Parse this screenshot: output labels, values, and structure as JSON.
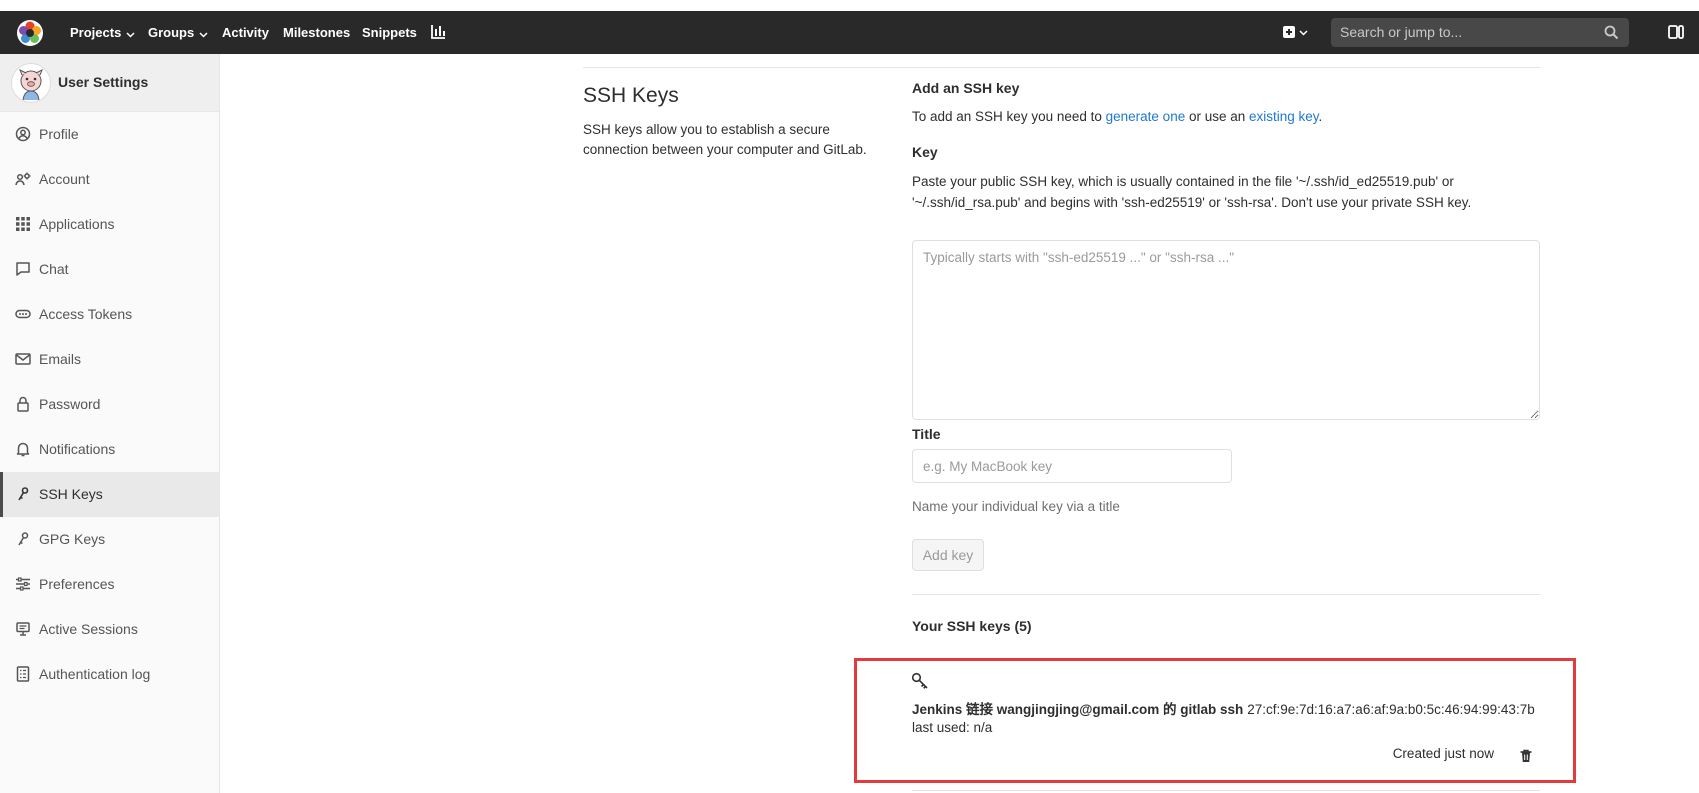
{
  "navbar": {
    "projects_label": "Projects",
    "groups_label": "Groups",
    "activity_label": "Activity",
    "milestones_label": "Milestones",
    "snippets_label": "Snippets",
    "search_placeholder": "Search or jump to..."
  },
  "sidebar": {
    "title": "User Settings",
    "active_item": "SSH Keys",
    "items": [
      {
        "label": "Profile",
        "icon": "profile-icon"
      },
      {
        "label": "Account",
        "icon": "account-icon"
      },
      {
        "label": "Applications",
        "icon": "applications-icon"
      },
      {
        "label": "Chat",
        "icon": "chat-icon"
      },
      {
        "label": "Access Tokens",
        "icon": "access-tokens-icon"
      },
      {
        "label": "Emails",
        "icon": "email-icon"
      },
      {
        "label": "Password",
        "icon": "lock-icon"
      },
      {
        "label": "Notifications",
        "icon": "bell-icon"
      },
      {
        "label": "SSH Keys",
        "icon": "key-icon"
      },
      {
        "label": "GPG Keys",
        "icon": "key-icon"
      },
      {
        "label": "Preferences",
        "icon": "preferences-icon"
      },
      {
        "label": "Active Sessions",
        "icon": "monitor-icon"
      },
      {
        "label": "Authentication log",
        "icon": "log-icon"
      }
    ]
  },
  "section": {
    "title": "SSH Keys",
    "description": "SSH keys allow you to establish a secure connection between your computer and GitLab."
  },
  "add_key": {
    "heading": "Add an SSH key",
    "intro_prefix": "To add an SSH key you need to ",
    "generate_link": "generate one",
    "intro_middle": " or use an ",
    "existing_link": "existing key",
    "intro_suffix": ".",
    "key_label": "Key",
    "key_help_line1": "Paste your public SSH key, which is usually contained in the file '~/.ssh/id_ed25519.pub' or",
    "key_help_line2": "'~/.ssh/id_rsa.pub' and begins with 'ssh-ed25519' or 'ssh-rsa'. Don't use your private SSH key.",
    "key_placeholder": "Typically starts with \"ssh-ed25519 ...\" or \"ssh-rsa ...\"",
    "title_label": "Title",
    "title_placeholder": "e.g. My MacBook key",
    "title_help": "Name your individual key via a title",
    "add_button": "Add key"
  },
  "your_keys": {
    "heading": "Your SSH keys (5)",
    "keys": [
      {
        "title": "Jenkins 链接 wangjingjing@gmail.com 的 gitlab ssh",
        "fingerprint": "27:cf:9e:7d:16:a7:a6:af:9a:b0:5c:46:94:99:43:7b",
        "last_used": "last used: n/a",
        "created": "Created just now"
      }
    ]
  },
  "colors": {
    "navbar_bg": "#292929",
    "link": "#1f78d1",
    "highlight_box": "#e33b3b"
  }
}
